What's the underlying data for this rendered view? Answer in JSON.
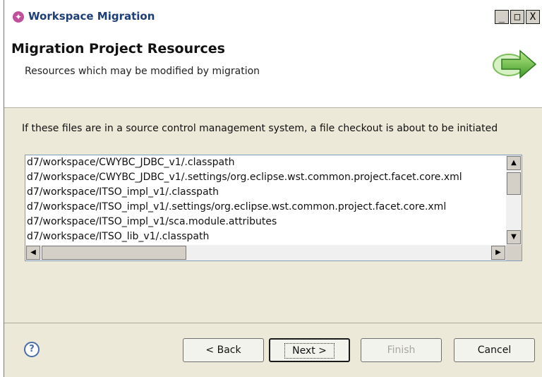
{
  "window": {
    "title": "Workspace Migration",
    "controls": {
      "minimize": "_",
      "maximize": "□",
      "close": "X"
    }
  },
  "header": {
    "title": "Migration Project Resources",
    "subtitle": "Resources which may be modified by migration",
    "icon": "green-arrow-icon"
  },
  "info_text": "If these files are in a source control management system, a file checkout is about to be initiated",
  "files": [
    "d7/workspace/CWYBC_JDBC_v1/.classpath",
    "d7/workspace/CWYBC_JDBC_v1/.settings/org.eclipse.wst.common.project.facet.core.xml",
    "d7/workspace/ITSO_impl_v1/.classpath",
    "d7/workspace/ITSO_impl_v1/.settings/org.eclipse.wst.common.project.facet.core.xml",
    "d7/workspace/ITSO_impl_v1/sca.module.attributes",
    "d7/workspace/ITSO_lib_v1/.classpath"
  ],
  "scroll": {
    "up": "▲",
    "down": "▼",
    "left": "◀",
    "right": "▶"
  },
  "footer": {
    "help": "?",
    "back": "< Back",
    "next": "Next >",
    "finish": "Finish",
    "cancel": "Cancel"
  }
}
